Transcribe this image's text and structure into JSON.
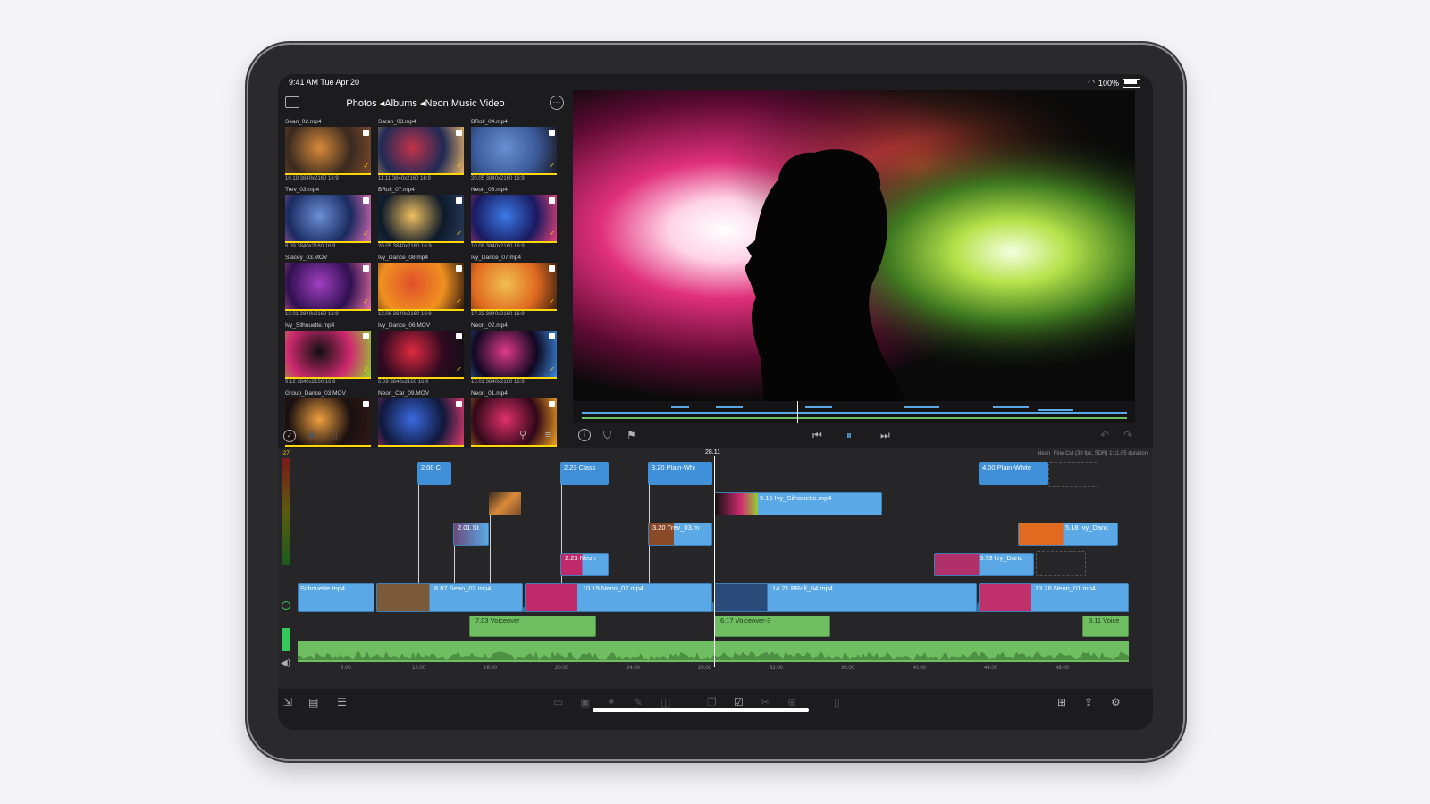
{
  "status_bar": {
    "time": "9:41 AM  Tue Apr 20",
    "battery": "100%"
  },
  "browser": {
    "breadcrumb": "Photos ◂Albums ◂Neon Music Video",
    "clips": [
      {
        "name": "Sean_02.mp4",
        "meta": "10.19  3840x2160  16:9",
        "colors": [
          "#3a2a20",
          "#d98a3a",
          "#7a4a2a"
        ]
      },
      {
        "name": "Sarah_03.mp4",
        "meta": "11.11  3840x2160  16:9",
        "colors": [
          "#1f2a55",
          "#c2334a",
          "#e7b36a"
        ]
      },
      {
        "name": "BRoll_04.mp4",
        "meta": "20.05  3840x2160  16:9",
        "colors": [
          "#3b5a9a",
          "#6a8fd0",
          "#1a1a22"
        ]
      },
      {
        "name": "Trev_03.mp4",
        "meta": "8.09  3840x2160  16:9",
        "colors": [
          "#1a2a60",
          "#6b8fd6",
          "#d96ab0"
        ]
      },
      {
        "name": "BRoll_07.mp4",
        "meta": "20.05  3840x2160  16:9",
        "colors": [
          "#0d1a2a",
          "#f0c060",
          "#2a3a5a"
        ]
      },
      {
        "name": "Neon_06.mp4",
        "meta": "10.08  3840x2160  16:9",
        "colors": [
          "#1a1a60",
          "#3a7ae6",
          "#e6407a"
        ]
      },
      {
        "name": "Stacey_03.MOV",
        "meta": "13.01  3840x2160  16:9",
        "colors": [
          "#301050",
          "#a040c0",
          "#e070a0"
        ]
      },
      {
        "name": "Ivy_Dance_08.mp4",
        "meta": "13.06  3840x2160  16:9",
        "colors": [
          "#f09020",
          "#e0502a",
          "#301a10"
        ]
      },
      {
        "name": "Ivy_Dance_07.mp4",
        "meta": "17.23  3840x2160  16:9",
        "colors": [
          "#e06a20",
          "#f0c050",
          "#402010"
        ]
      },
      {
        "name": "Ivy_Silhouette.mp4",
        "meta": "9.12  3840x2160  16:9",
        "colors": [
          "#d02a70",
          "#101010",
          "#90d030"
        ]
      },
      {
        "name": "Ivy_Dance_06.MOV",
        "meta": "6.09  3840x2160  16:9",
        "colors": [
          "#300a20",
          "#e02a40",
          "#101018"
        ]
      },
      {
        "name": "Neon_02.mp4",
        "meta": "15.01  3840x2160  16:9",
        "colors": [
          "#100820",
          "#e03a8a",
          "#3a8ae0"
        ]
      },
      {
        "name": "Group_Dance_03.MOV",
        "meta": "",
        "colors": [
          "#1a1010",
          "#f0a040",
          "#301818"
        ]
      },
      {
        "name": "Neon_Car_09.MOV",
        "meta": "",
        "colors": [
          "#10183a",
          "#3a6ae0",
          "#e03a6a"
        ]
      },
      {
        "name": "Neon_01.mp4",
        "meta": "",
        "colors": [
          "#300818",
          "#e0306a",
          "#f0a020"
        ]
      }
    ]
  },
  "viewer": {
    "timecode": "28.11"
  },
  "timeline": {
    "project_info": "Neon_Fine Cut (30 fps, SDR)  1:11.05 duration",
    "meter_top": "-27",
    "ruler": [
      "8.00",
      "12.00",
      "16.00",
      "20.00",
      "24.00",
      "28.00",
      "32.00",
      "36.00",
      "40.00",
      "44.00",
      "48.00"
    ],
    "titles": [
      {
        "label": "2.00  C"
      },
      {
        "label": "2.23  Class"
      },
      {
        "label": "3.20  Plain-Whi"
      },
      {
        "label": "4.00  Plain-White"
      }
    ],
    "connected": [
      {
        "label": "9.15  Ivy_Silhouette.mp4"
      },
      {
        "label": "2.01  St"
      },
      {
        "label": "3.20  Trev_03.m"
      },
      {
        "label": "2.23  Neon"
      },
      {
        "label": "5.73  Ivy_Danc"
      },
      {
        "label": "5.18  Ivy_Danc"
      }
    ],
    "primary": [
      {
        "label": "Silhouette.mp4"
      },
      {
        "label": "8.07  Sean_02.mp4"
      },
      {
        "label": "10.19  Neon_02.mp4"
      },
      {
        "label": "14.21  BRoll_04.mp4"
      },
      {
        "label": "13.26  Neon_01.mp4"
      }
    ],
    "voiceovers": [
      {
        "label": "7.03  Voiceover"
      },
      {
        "label": "6.17  Voiceover-3"
      },
      {
        "label": "3.11  Voice"
      }
    ]
  },
  "colors": {
    "accent": "#3f8fd9",
    "audio": "#6fbf62",
    "check": "#ffd60a"
  }
}
